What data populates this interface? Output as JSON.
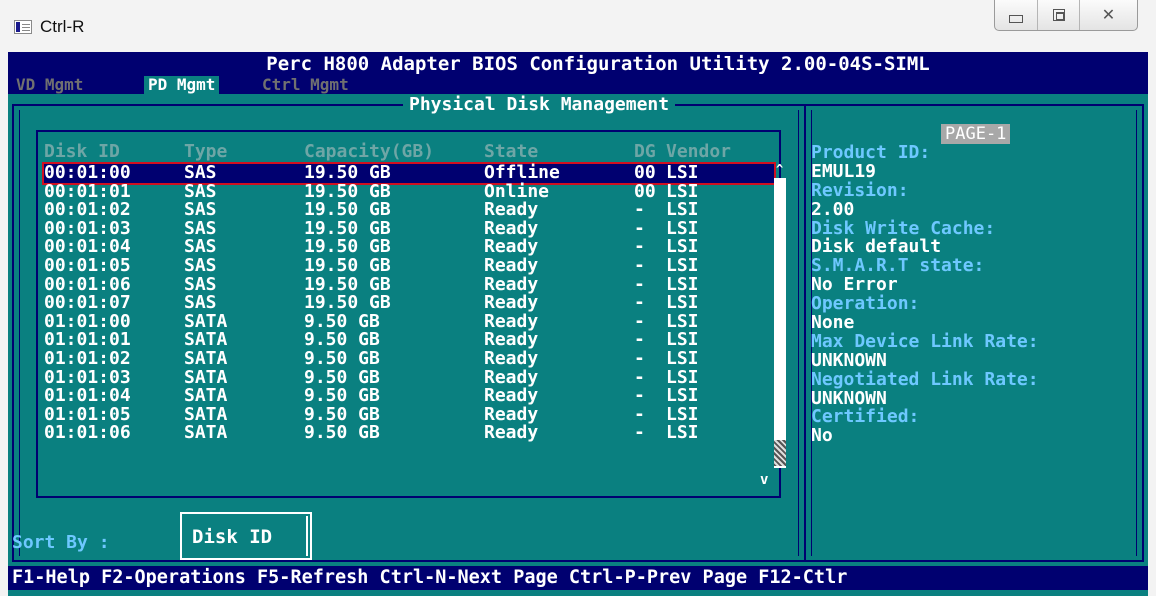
{
  "window": {
    "title": "Ctrl-R"
  },
  "bios": {
    "header": "Perc H800 Adapter BIOS Configuration Utility 2.00-04S-SIML",
    "tabs": [
      "VD Mgmt",
      "PD Mgmt",
      "Ctrl Mgmt"
    ],
    "active_tab": "PD Mgmt",
    "panel_title": "Physical Disk Management",
    "columns": {
      "disk_id": "Disk ID",
      "type": "Type",
      "capacity": "Capacity(GB)",
      "state": "State",
      "dg": "DG",
      "vendor": "Vendor"
    },
    "disks": [
      {
        "id": "00:01:00",
        "type": "SAS",
        "capacity": "19.50 GB",
        "state": "Offline",
        "dg": "00",
        "vendor": "LSI"
      },
      {
        "id": "00:01:01",
        "type": "SAS",
        "capacity": "19.50 GB",
        "state": "Online",
        "dg": "00",
        "vendor": "LSI"
      },
      {
        "id": "00:01:02",
        "type": "SAS",
        "capacity": "19.50 GB",
        "state": "Ready",
        "dg": "-",
        "vendor": "LSI"
      },
      {
        "id": "00:01:03",
        "type": "SAS",
        "capacity": "19.50 GB",
        "state": "Ready",
        "dg": "-",
        "vendor": "LSI"
      },
      {
        "id": "00:01:04",
        "type": "SAS",
        "capacity": "19.50 GB",
        "state": "Ready",
        "dg": "-",
        "vendor": "LSI"
      },
      {
        "id": "00:01:05",
        "type": "SAS",
        "capacity": "19.50 GB",
        "state": "Ready",
        "dg": "-",
        "vendor": "LSI"
      },
      {
        "id": "00:01:06",
        "type": "SAS",
        "capacity": "19.50 GB",
        "state": "Ready",
        "dg": "-",
        "vendor": "LSI"
      },
      {
        "id": "00:01:07",
        "type": "SAS",
        "capacity": "19.50 GB",
        "state": "Ready",
        "dg": "-",
        "vendor": "LSI"
      },
      {
        "id": "01:01:00",
        "type": "SATA",
        "capacity": "9.50 GB",
        "state": "Ready",
        "dg": "-",
        "vendor": "LSI"
      },
      {
        "id": "01:01:01",
        "type": "SATA",
        "capacity": "9.50 GB",
        "state": "Ready",
        "dg": "-",
        "vendor": "LSI"
      },
      {
        "id": "01:01:02",
        "type": "SATA",
        "capacity": "9.50 GB",
        "state": "Ready",
        "dg": "-",
        "vendor": "LSI"
      },
      {
        "id": "01:01:03",
        "type": "SATA",
        "capacity": "9.50 GB",
        "state": "Ready",
        "dg": "-",
        "vendor": "LSI"
      },
      {
        "id": "01:01:04",
        "type": "SATA",
        "capacity": "9.50 GB",
        "state": "Ready",
        "dg": "-",
        "vendor": "LSI"
      },
      {
        "id": "01:01:05",
        "type": "SATA",
        "capacity": "9.50 GB",
        "state": "Ready",
        "dg": "-",
        "vendor": "LSI"
      },
      {
        "id": "01:01:06",
        "type": "SATA",
        "capacity": "9.50 GB",
        "state": "Ready",
        "dg": "-",
        "vendor": "LSI"
      }
    ],
    "selected_index": 0,
    "scroll": {
      "up_glyph": "^",
      "down_glyph": "v"
    },
    "side": {
      "page": "PAGE-1",
      "product_id_label": "Product ID:",
      "product_id": "EMUL19",
      "revision_label": "Revision:",
      "revision": "2.00",
      "write_cache_label": "Disk Write Cache:",
      "write_cache": "Disk default",
      "smart_label": "S.M.A.R.T state:",
      "smart": "No Error",
      "operation_label": "Operation:",
      "operation": "None",
      "max_link_label": "Max Device Link Rate:",
      "max_link": "UNKNOWN",
      "neg_link_label": "Negotiated Link Rate:",
      "neg_link": "UNKNOWN",
      "certified_label": "Certified:",
      "certified": "No"
    },
    "sort": {
      "label": "Sort By :",
      "value": "Disk ID"
    },
    "footer": "F1-Help F2-Operations F5-Refresh Ctrl-N-Next Page Ctrl-P-Prev Page F12-Ctlr"
  },
  "colors": {
    "console_bg": "#0a8080",
    "header_bg": "#000070",
    "selection_outline": "#d01020",
    "label_cyan": "#6ec8ff"
  }
}
